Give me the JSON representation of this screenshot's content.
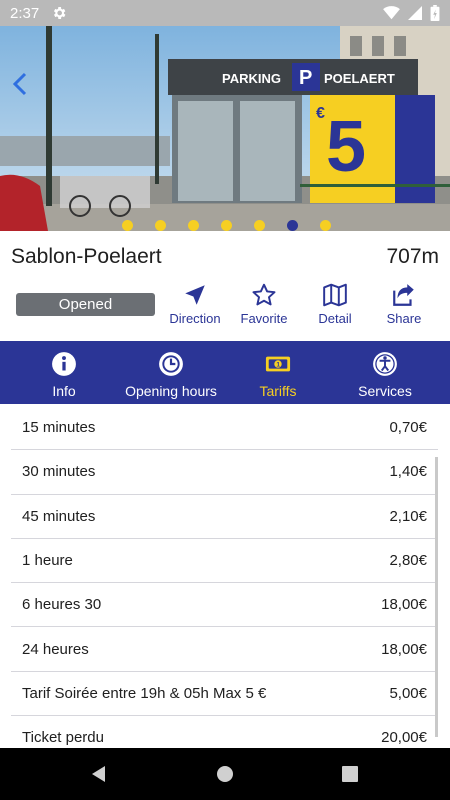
{
  "status_bar": {
    "time": "2:37"
  },
  "hero": {
    "photo_sign_text": "PARKING",
    "photo_sign_text_2": "POELAERT",
    "photo_ad_price": "5",
    "photo_ad_euro": "€",
    "slide_count": 7,
    "active_slide": 5
  },
  "parking": {
    "name": "Sablon-Poelaert",
    "distance": "707m",
    "status": "Opened"
  },
  "actions": [
    {
      "label": "Direction",
      "icon": "navigation-arrow-icon"
    },
    {
      "label": "Favorite",
      "icon": "star-outline-icon"
    },
    {
      "label": "Detail",
      "icon": "map-icon"
    },
    {
      "label": "Share",
      "icon": "share-icon"
    }
  ],
  "tabs": [
    {
      "label": "Info",
      "icon": "info-icon",
      "active": false
    },
    {
      "label": "Opening hours",
      "icon": "clock-icon",
      "active": false
    },
    {
      "label": "Tariffs",
      "icon": "banknote-icon",
      "active": true
    },
    {
      "label": "Services",
      "icon": "accessibility-icon",
      "active": false
    }
  ],
  "tariffs": [
    {
      "label": "15 minutes",
      "price": "0,70€"
    },
    {
      "label": "30 minutes",
      "price": "1,40€"
    },
    {
      "label": "45 minutes",
      "price": "2,10€"
    },
    {
      "label": "1 heure",
      "price": "2,80€"
    },
    {
      "label": "6 heures 30",
      "price": "18,00€"
    },
    {
      "label": "24 heures",
      "price": "18,00€"
    },
    {
      "label": "Tarif Soirée entre 19h & 05h Max 5 €",
      "price": "5,00€"
    },
    {
      "label": "Ticket perdu",
      "price": "20,00€"
    }
  ],
  "colors": {
    "brand_blue": "#2b3596",
    "accent_yellow": "#f6cf22",
    "badge_gray": "#6b6f74"
  }
}
